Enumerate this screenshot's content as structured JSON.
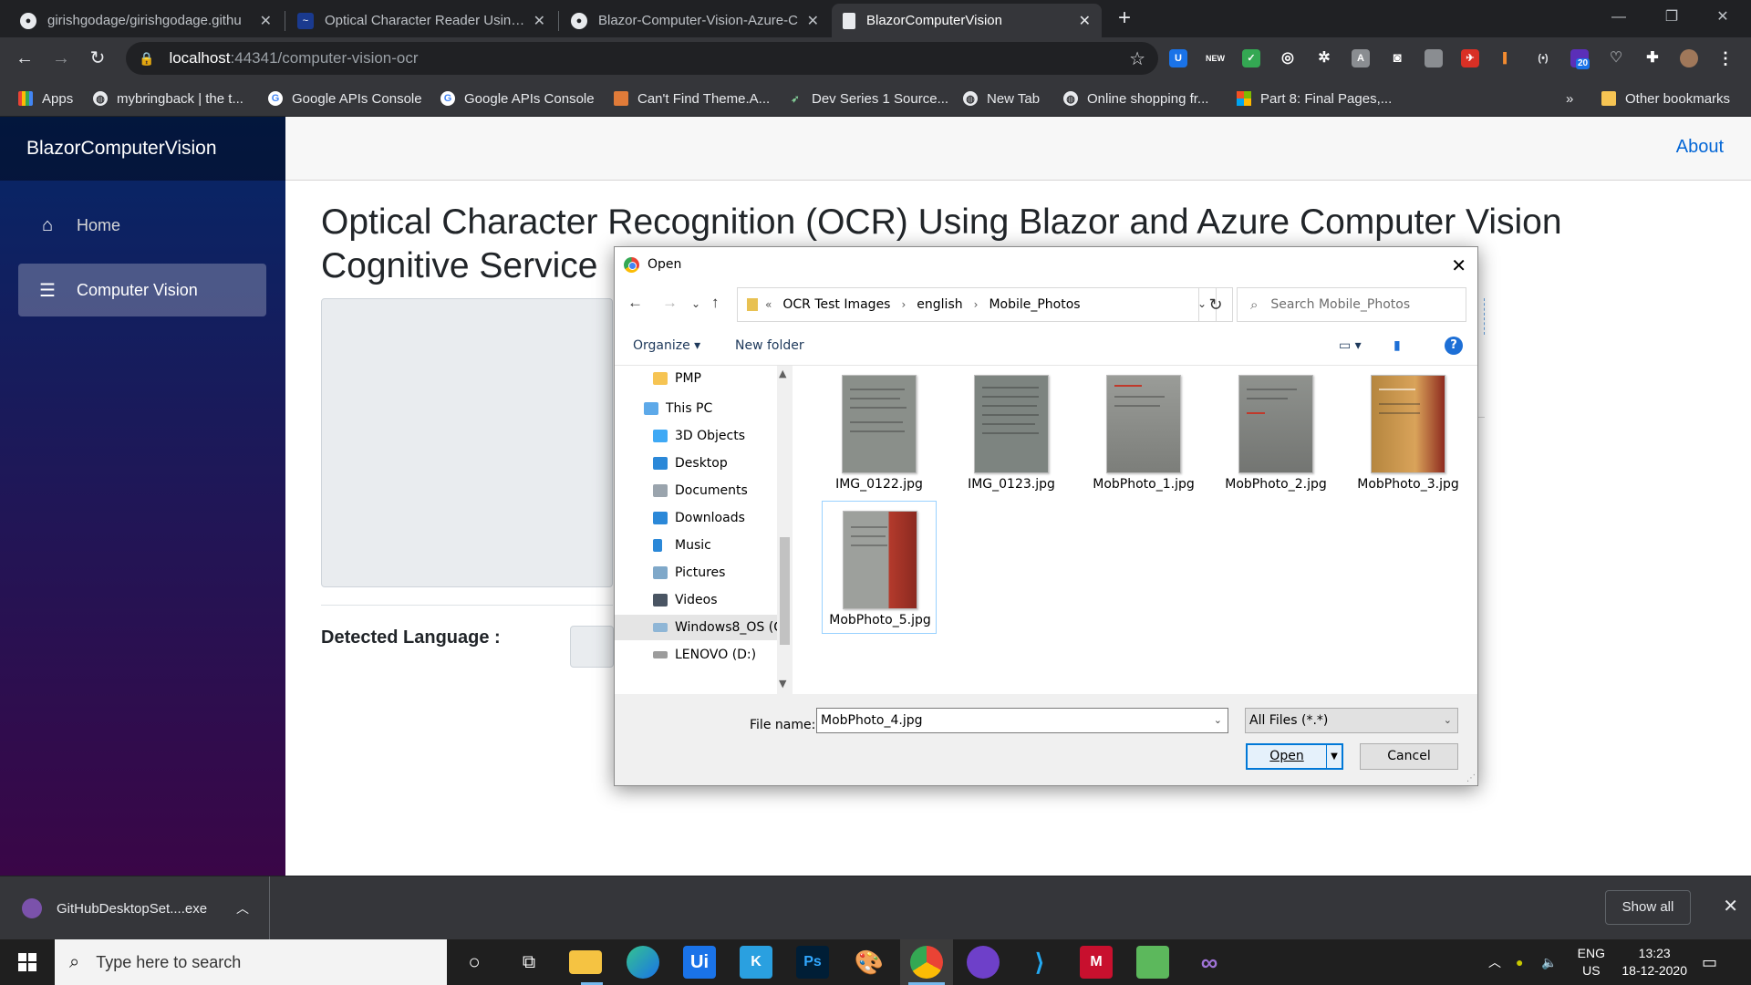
{
  "browser": {
    "tabs": [
      {
        "title": "girishgodage/girishgodage.githu"
      },
      {
        "title": "Optical Character Reader Using B"
      },
      {
        "title": "Blazor-Computer-Vision-Azure-C"
      },
      {
        "title": "BlazorComputerVision"
      }
    ],
    "new_tab": "+",
    "url_host": "localhost",
    "url_rest": ":44341/computer-vision-ocr",
    "extension_badge": "20",
    "bookmarks": [
      "Apps",
      "mybringback | the t...",
      "Google APIs Console",
      "Google APIs Console",
      "Can't Find Theme.A...",
      "Dev Series 1 Source...",
      "New Tab",
      "Online shopping fr...",
      "Part 8: Final Pages,..."
    ],
    "bookmarks_overflow": "»",
    "other_bookmarks": "Other bookmarks"
  },
  "app": {
    "brand": "BlazorComputerVision",
    "nav": [
      {
        "label": "Home",
        "icon": "home-icon"
      },
      {
        "label": "Computer Vision",
        "icon": "list-icon"
      }
    ],
    "about_link": "About",
    "heading": "Optical Character Recognition (OCR) Using Blazor and Azure Computer Vision Cognitive Service",
    "detected_language_label": "Detected Language :"
  },
  "dialog": {
    "title": "Open",
    "path": [
      "OCR Test Images",
      "english",
      "Mobile_Photos"
    ],
    "path_prefix": "«",
    "search_placeholder": "Search Mobile_Photos",
    "organize": "Organize",
    "new_folder": "New folder",
    "help": "?",
    "nav_tree": [
      {
        "label": "PMP",
        "icon": "folder-icon"
      },
      {
        "label": "This PC",
        "icon": "computer-icon"
      },
      {
        "label": "3D Objects",
        "icon": "cube-icon"
      },
      {
        "label": "Desktop",
        "icon": "desktop-icon"
      },
      {
        "label": "Documents",
        "icon": "document-icon"
      },
      {
        "label": "Downloads",
        "icon": "download-icon"
      },
      {
        "label": "Music",
        "icon": "music-icon"
      },
      {
        "label": "Pictures",
        "icon": "pictures-icon"
      },
      {
        "label": "Videos",
        "icon": "video-icon"
      },
      {
        "label": "Windows8_OS (C",
        "icon": "drive-icon"
      },
      {
        "label": "LENOVO (D:)",
        "icon": "drive-icon"
      }
    ],
    "files": [
      {
        "name": "IMG_0122.jpg"
      },
      {
        "name": "IMG_0123.jpg"
      },
      {
        "name": "MobPhoto_1.jpg"
      },
      {
        "name": "MobPhoto_2.jpg"
      },
      {
        "name": "MobPhoto_3.jpg"
      },
      {
        "name": "MobPhoto_5.jpg"
      }
    ],
    "file_name_label": "File name:",
    "file_name_value": "MobPhoto_4.jpg",
    "file_type": "All Files (*.*)",
    "open_button": "Open",
    "cancel_button": "Cancel"
  },
  "downloads": {
    "item": "GitHubDesktopSet....exe",
    "show_all": "Show all"
  },
  "taskbar": {
    "search_placeholder": "Type here to search",
    "language_top": "ENG",
    "language_bottom": "US",
    "time": "13:23",
    "date": "18-12-2020"
  }
}
